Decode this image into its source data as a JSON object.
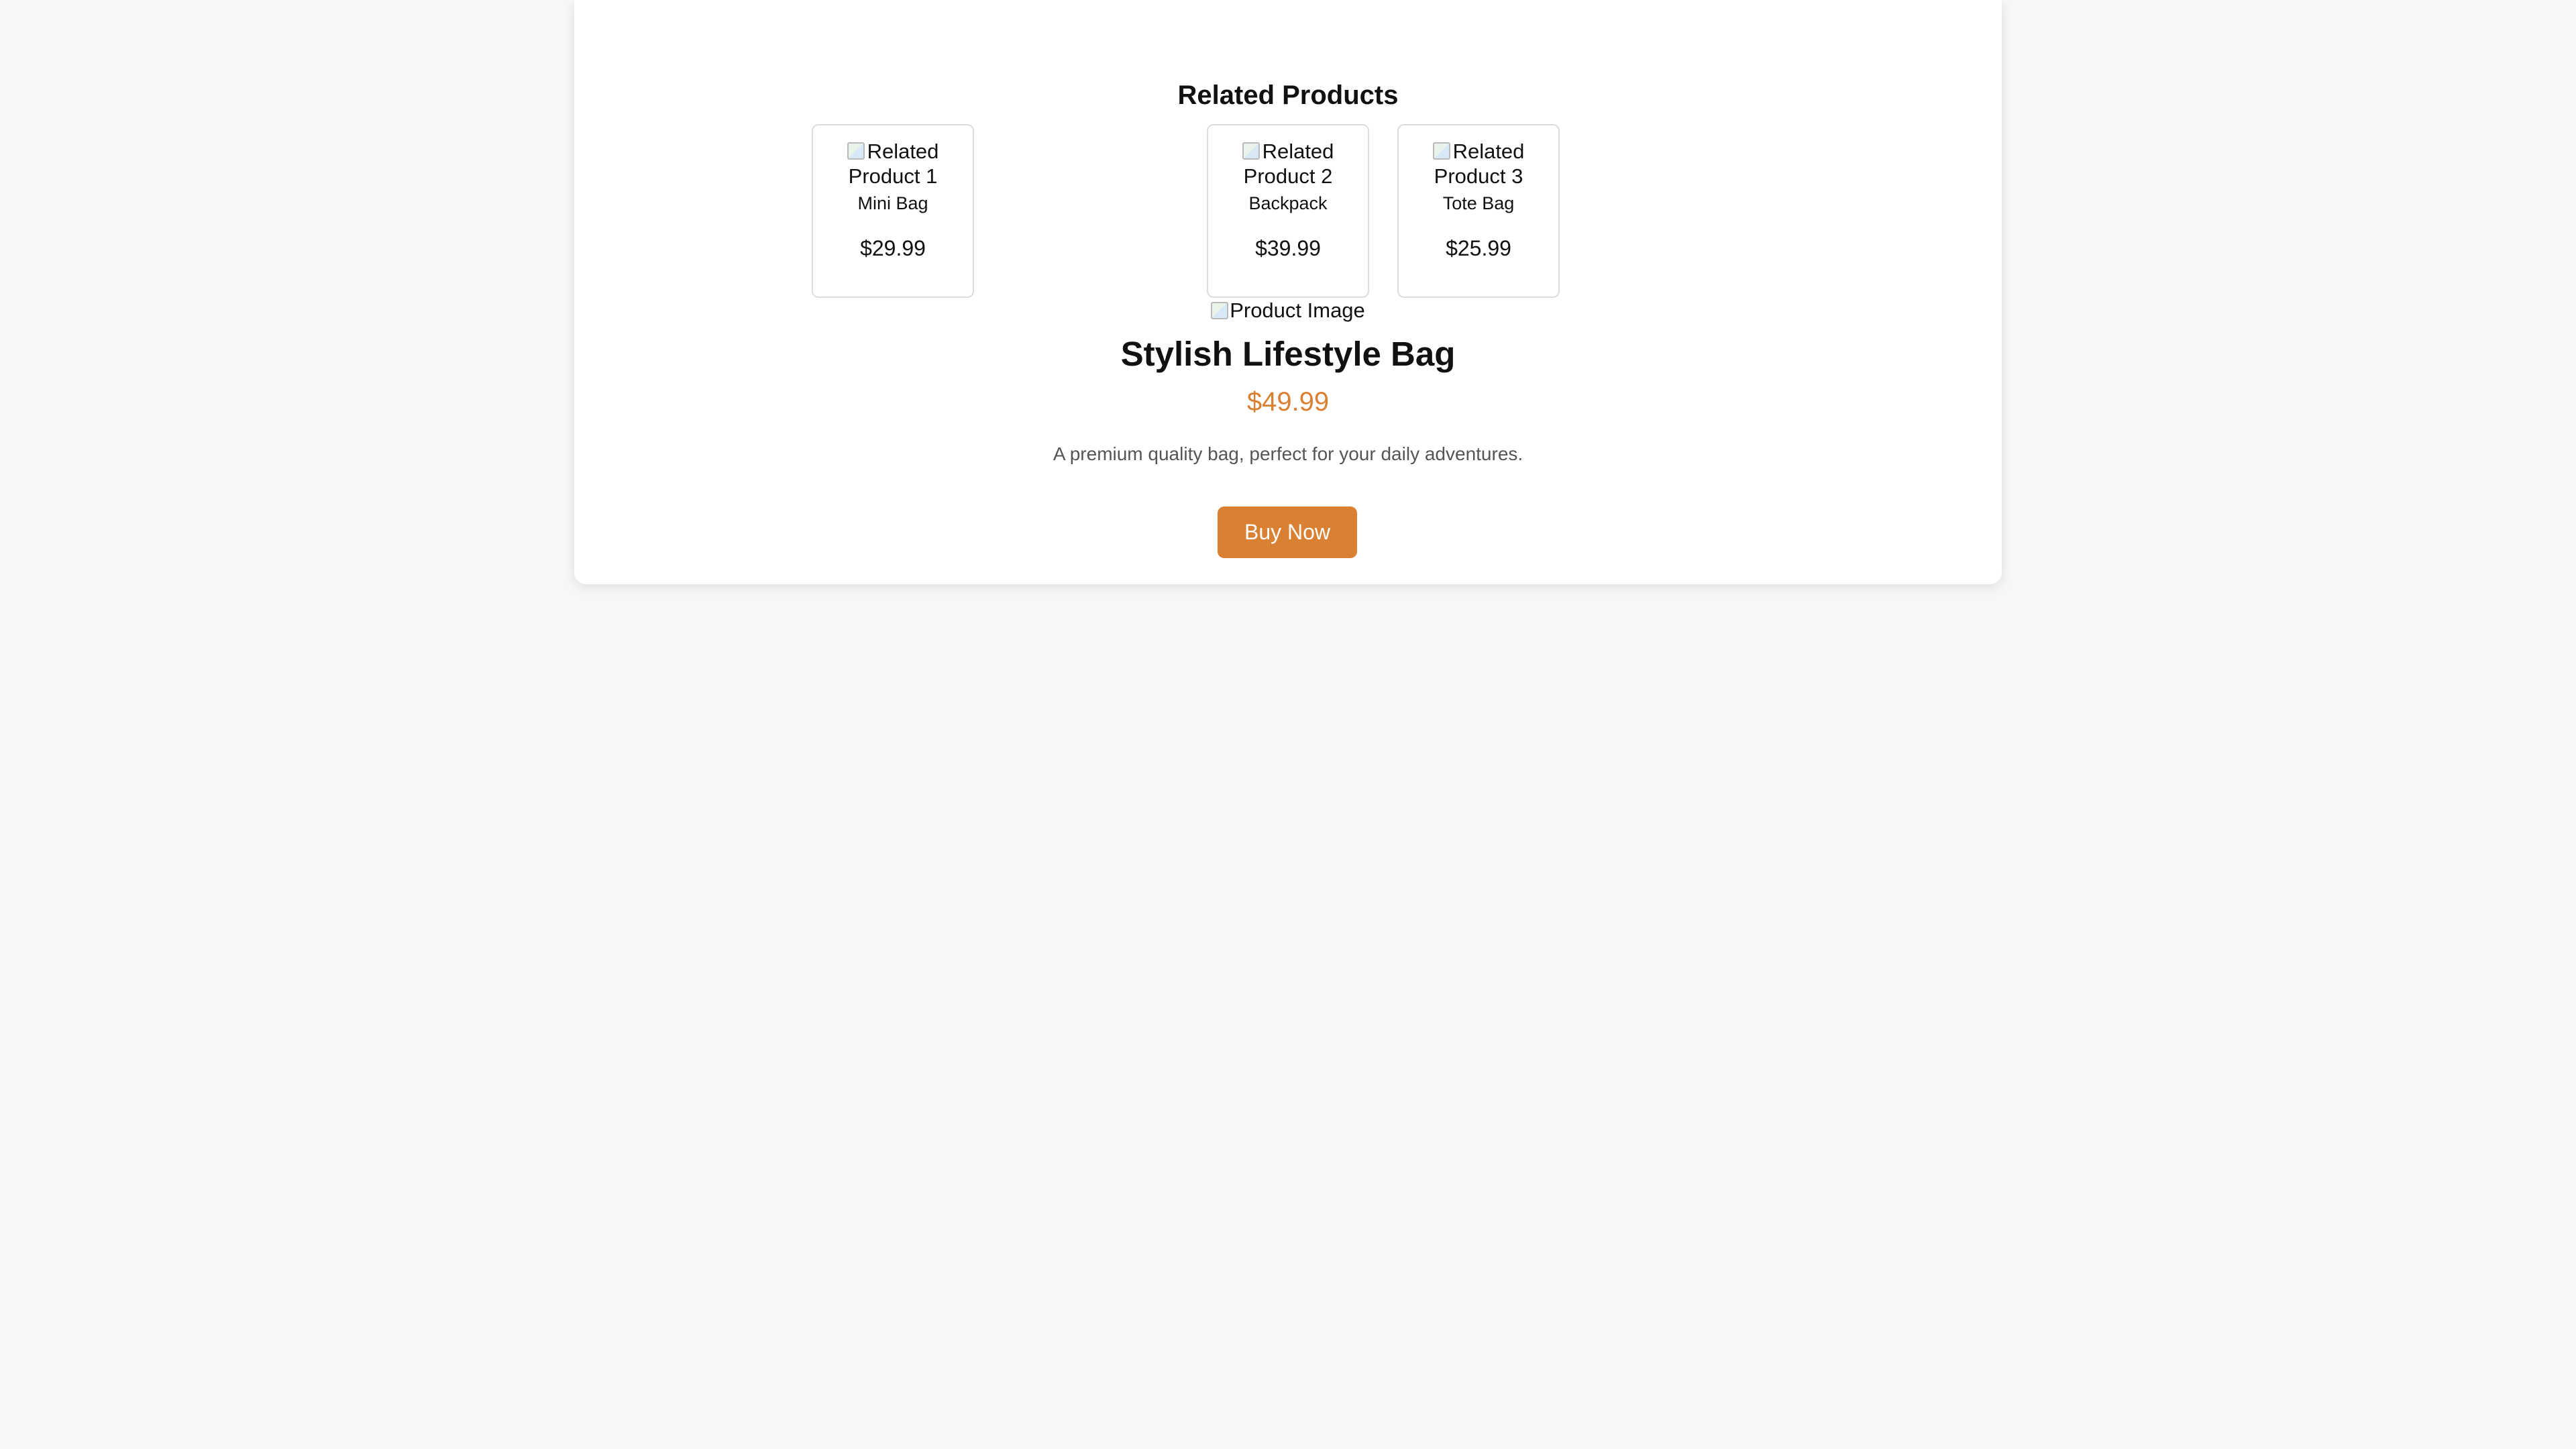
{
  "related": {
    "title": "Related Products",
    "items": [
      {
        "image_alt": "Related Product 1",
        "name": "Mini Bag",
        "price": "$29.99"
      },
      {
        "image_alt": "Related Product 2",
        "name": "Backpack",
        "price": "$39.99"
      },
      {
        "image_alt": "Related Product 3",
        "name": "Tote Bag",
        "price": "$25.99"
      }
    ]
  },
  "product": {
    "image_alt": "Product Image",
    "title": "Stylish Lifestyle Bag",
    "price": "$49.99",
    "description": "A premium quality bag, perfect for your daily adventures.",
    "buy_label": "Buy Now"
  },
  "colors": {
    "accent": "#d98032",
    "background": "#f7f7f7",
    "card": "#ffffff",
    "border": "#dddddd"
  },
  "icons": {
    "image_placeholder": "broken-image-icon"
  }
}
